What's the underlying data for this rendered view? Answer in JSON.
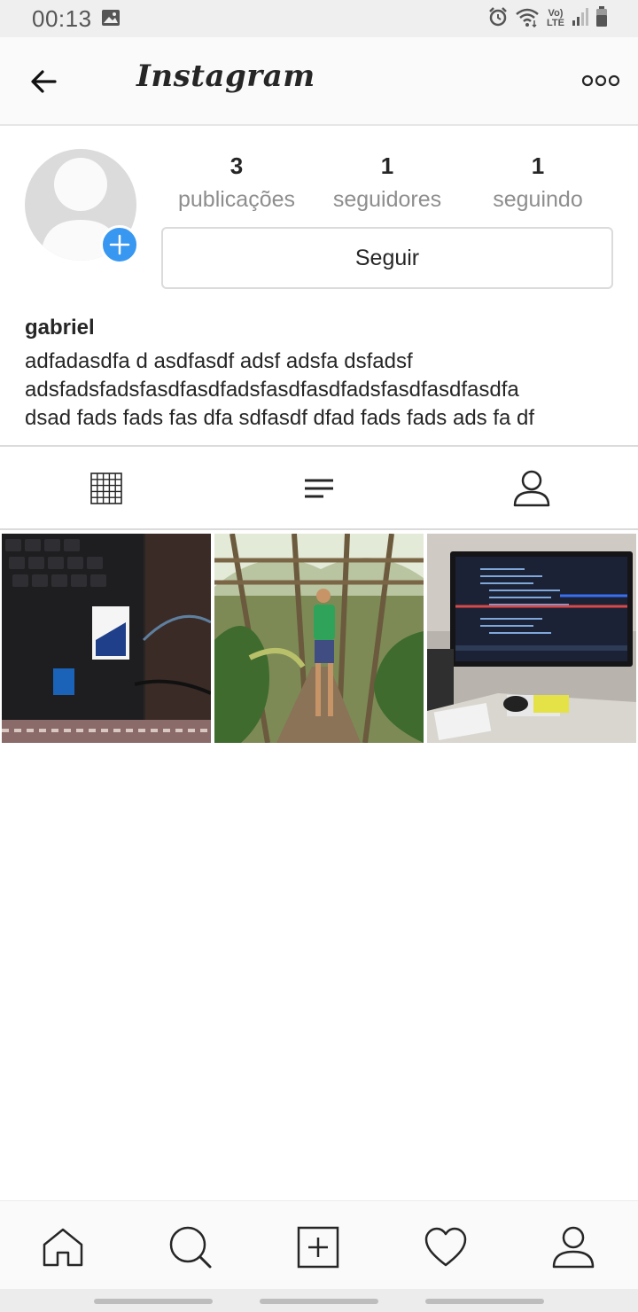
{
  "status_bar": {
    "time": "00:13",
    "network_label_1": "Vo)",
    "network_label_2": "LTE",
    "icons": [
      "gallery-icon",
      "alarm-icon",
      "wifi-icon",
      "signal-icon",
      "battery-icon"
    ]
  },
  "header": {
    "title": "Instagram",
    "back_icon": "arrow-left-icon",
    "more_icon": "more-dots-icon"
  },
  "profile": {
    "username": "gabriel",
    "bio_lines": [
      "adfadasdfa d asdfasdf adsf adsfa dsfadsf",
      "adsfadsfadsfasdfasdfadsfasdfasdfadsfasdfasdfasdfa",
      "dsad fads fads fas dfa sdfasdf dfad fads fads ads fa df"
    ],
    "stats": {
      "posts": {
        "value": "3",
        "label": "publicações"
      },
      "followers": {
        "value": "1",
        "label": "seguidores"
      },
      "following": {
        "value": "1",
        "label": "seguindo"
      }
    },
    "follow_button": "Seguir"
  },
  "tabs": [
    "grid-icon",
    "list-icon",
    "tagged-person-icon"
  ],
  "photos": [
    {
      "subject": "laptop-keyboard-photo"
    },
    {
      "subject": "person-in-garden-photo"
    },
    {
      "subject": "computer-monitor-photo"
    }
  ],
  "bottom_nav": [
    "home-icon",
    "search-icon",
    "add-post-icon",
    "heart-icon",
    "profile-icon"
  ],
  "colors": {
    "accent": "#3897f0",
    "text": "#262626",
    "muted": "#8e8e8e",
    "border": "#dbdbdb"
  }
}
